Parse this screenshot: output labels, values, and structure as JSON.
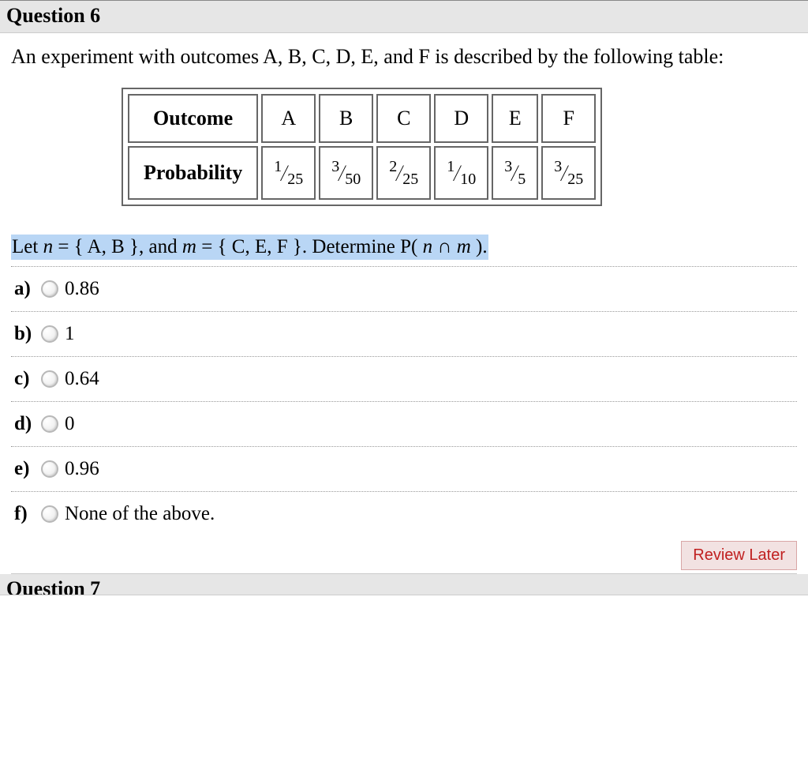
{
  "question": {
    "title": "Question 6",
    "stem": "An experiment with outcomes A, B, C, D, E, and F is described by the following table:",
    "table": {
      "row1_label": "Outcome",
      "row2_label": "Probability",
      "outcomes": [
        "A",
        "B",
        "C",
        "D",
        "E",
        "F"
      ],
      "probabilities": [
        {
          "num": "1",
          "den": "25"
        },
        {
          "num": "3",
          "den": "50"
        },
        {
          "num": "2",
          "den": "25"
        },
        {
          "num": "1",
          "den": "10"
        },
        {
          "num": "3",
          "den": "5"
        },
        {
          "num": "3",
          "den": "25"
        }
      ]
    },
    "prompt": {
      "pre": "Let  ",
      "n_lhs": "n",
      "eq1": " = { A, B }, and  ",
      "m_lhs": "m",
      "eq2": " = { C, E, F }.  Determine  P( ",
      "n2": "n",
      "cap": " ∩ ",
      "m2": "m",
      "end": " )."
    },
    "options": [
      {
        "letter": "a)",
        "text": "0.86"
      },
      {
        "letter": "b)",
        "text": "1"
      },
      {
        "letter": "c)",
        "text": "0.64"
      },
      {
        "letter": "d)",
        "text": "0"
      },
      {
        "letter": "e)",
        "text": "0.96"
      },
      {
        "letter": "f)",
        "text": "None of the above."
      }
    ],
    "review_label": "Review Later"
  },
  "next_question_title": "Question 7",
  "chart_data": {
    "type": "table",
    "title": "Outcome probabilities",
    "columns": [
      "Outcome",
      "A",
      "B",
      "C",
      "D",
      "E",
      "F"
    ],
    "rows": [
      {
        "label": "Probability",
        "values": [
          "1/25",
          "3/50",
          "2/25",
          "1/10",
          "3/5",
          "3/25"
        ]
      }
    ]
  }
}
